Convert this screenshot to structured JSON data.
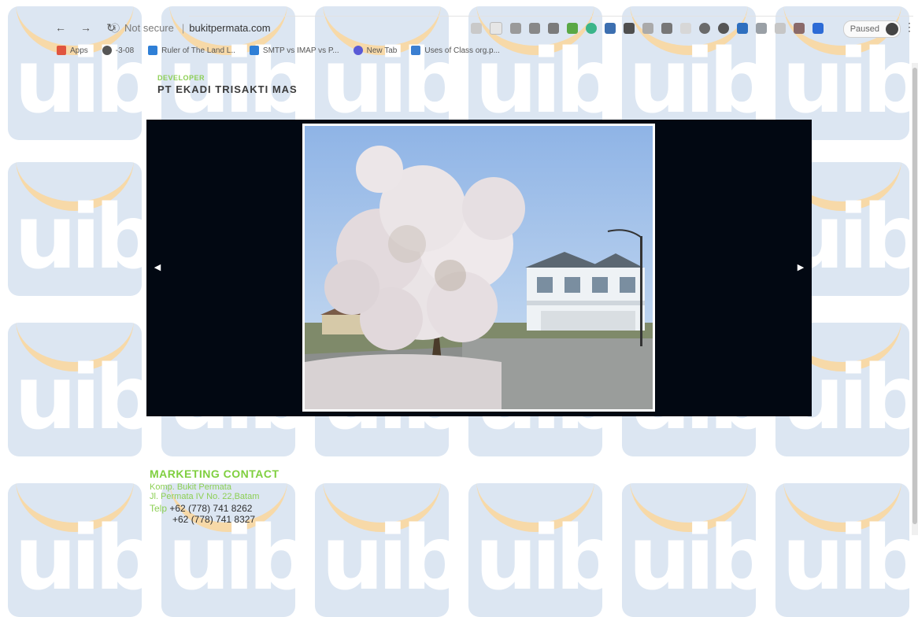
{
  "browser": {
    "security_label": "Not secure",
    "url": "bukitpermata.com",
    "profile_name": "Paused",
    "bookmarks": [
      {
        "label": "Apps",
        "icon": "apps-grid-icon",
        "color": "#e0553f"
      },
      {
        "label": "-3-08",
        "icon": "globe-icon",
        "color": "#555555"
      },
      {
        "label": "Ruler of The Land L..",
        "icon": "site-icon",
        "color": "#2f7fd6"
      },
      {
        "label": "SMTP vs IMAP vs P...",
        "icon": "site-icon",
        "color": "#2f7fd6"
      },
      {
        "label": "New Tab",
        "icon": "chrome-icon",
        "color": "#5a5ad6"
      },
      {
        "label": "Uses of Class org.p...",
        "icon": "doc-icon",
        "color": "#3b7fd1"
      }
    ]
  },
  "page": {
    "developer_label": "DEVELOPER",
    "developer_name": "PT EKADI TRISAKTI MAS",
    "contact": {
      "title": "MARKETING CONTACT",
      "address_line1": "Komp. Bukit Permata",
      "address_line2": "Jl. Permata IV No. 22,Batam",
      "phone_label": "Telp",
      "phone1": "+62 (778) 741 8262",
      "phone2": "+62 (778) 741 8327"
    }
  },
  "watermark": {
    "text": "uib"
  },
  "colors": {
    "accent_green": "#7fcf3f",
    "slider_bg": "#020812"
  }
}
